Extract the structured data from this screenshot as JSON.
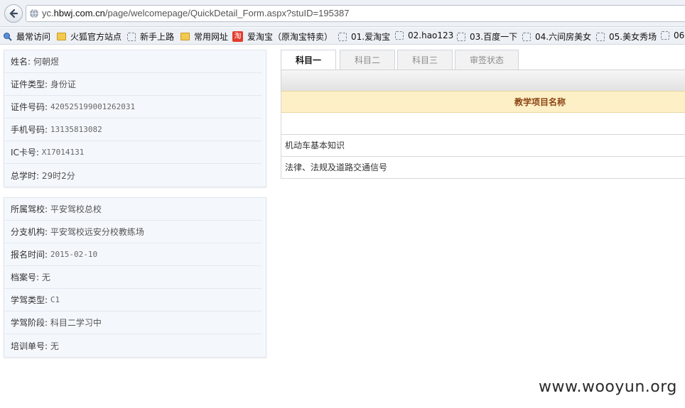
{
  "browser": {
    "url_prefix": "yc.",
    "url_domain": "hbwj.com.cn",
    "url_path": "/page/welcomepage/QuickDetail_Form.aspx?stuID=195387"
  },
  "bookmarks": [
    {
      "label": "最常访问",
      "icon": "magnifier-icon"
    },
    {
      "label": "火狐官方站点",
      "icon": "folder-icon"
    },
    {
      "label": "新手上路",
      "icon": "dashed-box-icon"
    },
    {
      "label": "常用网址",
      "icon": "folder-icon"
    },
    {
      "label": "爱淘宝（原淘宝特卖）",
      "icon": "taobao-icon"
    },
    {
      "label": "01.爱淘宝",
      "icon": "dashed-box-icon"
    },
    {
      "label": "02.hao123",
      "icon": "dashed-box-icon"
    },
    {
      "label": "03.百度一下",
      "icon": "dashed-box-icon"
    },
    {
      "label": "04.六间房美女",
      "icon": "dashed-box-icon"
    },
    {
      "label": "05.美女秀场",
      "icon": "dashed-box-icon"
    },
    {
      "label": "06",
      "icon": "dashed-box-icon"
    }
  ],
  "taobao_glyph": "淘",
  "student": {
    "name_label": "姓名:",
    "name": "何朝煜",
    "idtype_label": "证件类型:",
    "idtype": "身份证",
    "idno_label": "证件号码:",
    "idno": "420525199001262031",
    "phone_label": "手机号码:",
    "phone": "13135813082",
    "ic_label": "IC卡号:",
    "ic": "X17014131",
    "hours_label": "总学时:",
    "hours": "29时2分"
  },
  "school": {
    "school_label": "所属驾校:",
    "school": "平安驾校总校",
    "branch_label": "分支机构:",
    "branch": "平安驾校远安分校教练场",
    "regdate_label": "报名时间:",
    "regdate": "2015-02-10",
    "archive_label": "档案号:",
    "archive": "无",
    "cartype_label": "学驾类型:",
    "cartype": "C1",
    "stage_label": "学驾阶段:",
    "stage": "科目二学习中",
    "trainno_label": "培训单号:",
    "trainno": "无"
  },
  "tabs": [
    "科目一",
    "科目二",
    "科目三",
    "审签状态"
  ],
  "table": {
    "header": "教学项目名称",
    "rows": [
      "",
      "机动车基本知识",
      "法律、法规及道路交通信号"
    ]
  },
  "watermark": "www.wooyun.org",
  "colors": {
    "header_bg": "#fdefc6",
    "header_text": "#8b4513",
    "panel_bg": "#f4f8fd"
  }
}
